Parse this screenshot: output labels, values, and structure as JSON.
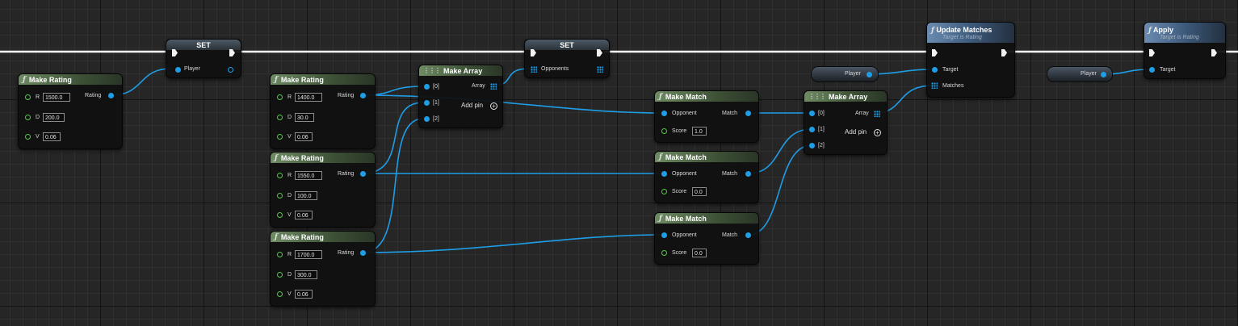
{
  "colors": {
    "exec_wire": "#ffffff",
    "data_wire": "#1e9ee6",
    "float_pin": "#56c74c",
    "function_header": "#4e6846",
    "target_header": "#3d5a7c"
  },
  "set_player": {
    "title": "SET",
    "pin": "Player"
  },
  "set_opponents": {
    "title": "SET",
    "pin": "Opponents"
  },
  "make_rating": {
    "title": "Make Rating",
    "output": "Rating",
    "r": "R",
    "d": "D",
    "v": "V"
  },
  "rating_player": {
    "r": "1500.0",
    "d": "200.0",
    "v": "0.06"
  },
  "rating_1": {
    "r": "1400.0",
    "d": "30.0",
    "v": "0.06"
  },
  "rating_2": {
    "r": "1550.0",
    "d": "100.0",
    "v": "0.06"
  },
  "rating_3": {
    "r": "1700.0",
    "d": "300.0",
    "v": "0.06"
  },
  "make_array": {
    "title": "Make Array",
    "output": "Array",
    "in0": "[0]",
    "in1": "[1]",
    "in2": "[2]",
    "add_pin": "Add pin"
  },
  "make_match": {
    "title": "Make Match",
    "opponent": "Opponent",
    "output": "Match",
    "score": "Score"
  },
  "match_scores": {
    "m1": "1.0",
    "m2": "0.0",
    "m3": "0.0"
  },
  "player_getter": {
    "label": "Player"
  },
  "update_matches": {
    "title": "Update Matches",
    "subtitle": "Target is Rating",
    "target": "Target",
    "matches": "Matches"
  },
  "apply": {
    "title": "Apply",
    "subtitle": "Target is Rating",
    "target": "Target"
  }
}
